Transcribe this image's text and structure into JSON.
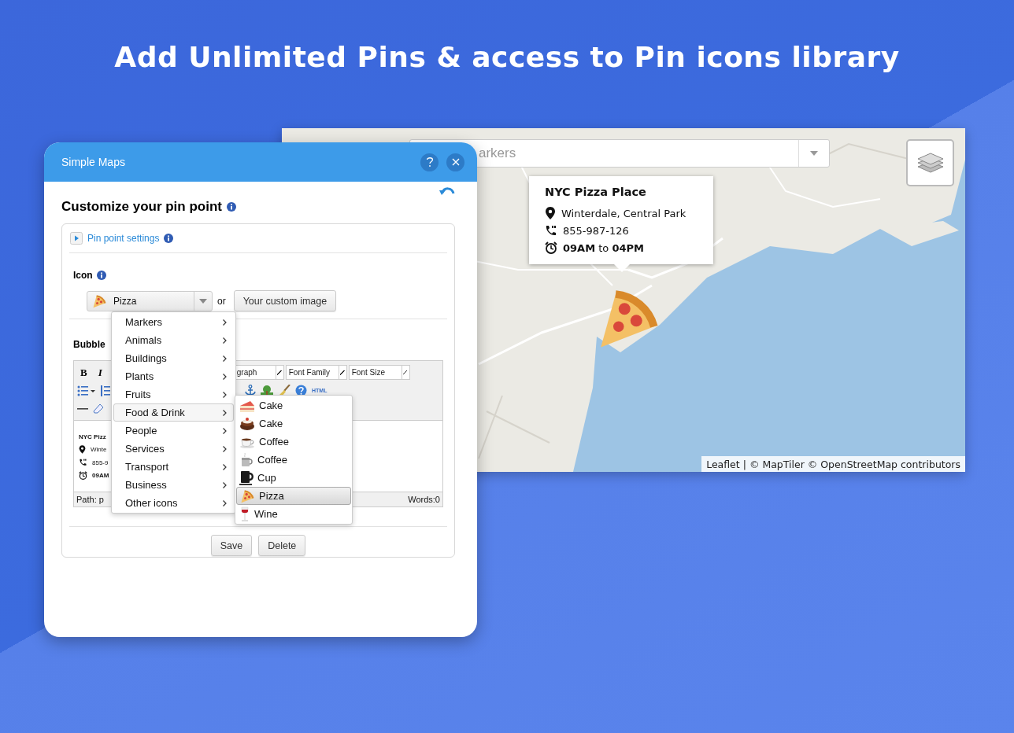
{
  "headline": "Add Unlimited Pins & access to Pin icons library",
  "map": {
    "search": {
      "value": "arkers"
    },
    "popup": {
      "title": "NYC Pizza Place",
      "lines": [
        {
          "kind": "location",
          "text": "Winterdale, Central Park"
        },
        {
          "kind": "phone",
          "text": "855-987-126"
        },
        {
          "kind": "hours",
          "text": "**09AM** to **04PM**"
        }
      ]
    },
    "attribution": {
      "link": "Leaflet",
      "separator": "|",
      "text": "© MapTiler © OpenStreetMap contributors"
    }
  },
  "dialog": {
    "title": "Simple Maps",
    "heading": "Customize your pin point",
    "section_link": "Pin point settings",
    "icon_label": "Icon",
    "icon_select": {
      "value": "Pizza"
    },
    "or_text": "or",
    "custom_image_button": "Your custom image",
    "bubble_label": "Bubble",
    "editor": {
      "toolbar": {
        "bold": "B",
        "italic": "I",
        "format_select": "graph",
        "font_family": "Font Family",
        "font_size": "Font Size",
        "html": "HTML"
      },
      "content": [
        {
          "kind": "title",
          "text": "NYC Pizz"
        },
        {
          "kind": "location",
          "text": "Winte"
        },
        {
          "kind": "phone",
          "text": "855-9"
        },
        {
          "kind": "hours",
          "text": "09AM"
        }
      ],
      "path": "Path: p",
      "words": "Words:0"
    },
    "buttons": [
      "Save",
      "Delete"
    ]
  },
  "icon_menu": {
    "categories": [
      {
        "label": "Markers",
        "selected": false
      },
      {
        "label": "Animals",
        "selected": false
      },
      {
        "label": "Buildings",
        "selected": false
      },
      {
        "label": "Plants",
        "selected": false
      },
      {
        "label": "Fruits",
        "selected": false
      },
      {
        "label": "Food & Drink",
        "selected": true
      },
      {
        "label": "People",
        "selected": false
      },
      {
        "label": "Services",
        "selected": false
      },
      {
        "label": "Transport",
        "selected": false
      },
      {
        "label": "Business",
        "selected": false
      },
      {
        "label": "Other icons",
        "selected": false
      }
    ],
    "items": [
      {
        "kind": "cake-slice",
        "label": "Cake",
        "selected": false
      },
      {
        "kind": "cake",
        "label": "Cake",
        "selected": false
      },
      {
        "kind": "coffee-cup",
        "label": "Coffee",
        "selected": false
      },
      {
        "kind": "coffee-pot",
        "label": "Coffee",
        "selected": false
      },
      {
        "kind": "mug",
        "label": "Cup",
        "selected": false
      },
      {
        "kind": "pizza",
        "label": "Pizza",
        "selected": true
      },
      {
        "kind": "wine",
        "label": "Wine",
        "selected": false
      }
    ]
  }
}
